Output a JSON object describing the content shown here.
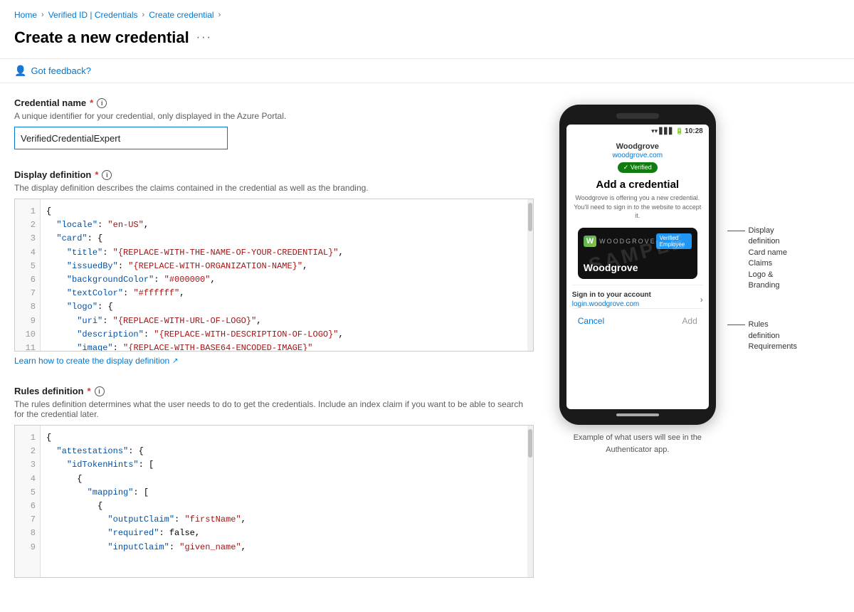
{
  "breadcrumb": {
    "home": "Home",
    "verified_id": "Verified ID | Credentials",
    "create_credential": "Create credential",
    "sep": "›"
  },
  "page_title": "Create a new credential",
  "page_title_menu": "···",
  "feedback": {
    "label": "Got feedback?"
  },
  "credential_name": {
    "label": "Credential name",
    "required": "*",
    "description": "A unique identifier for your credential, only displayed in the Azure Portal.",
    "value": "VerifiedCredentialExpert",
    "placeholder": ""
  },
  "display_definition": {
    "label": "Display definition",
    "required": "*",
    "description": "The display definition describes the claims contained in the credential as well as the branding.",
    "learn_link": "Learn how to create the display definition",
    "code_lines": [
      {
        "num": "1",
        "content": "{"
      },
      {
        "num": "2",
        "content": "  \"locale\": \"en-US\","
      },
      {
        "num": "3",
        "content": "  \"card\": {"
      },
      {
        "num": "4",
        "content": "    \"title\": \"{REPLACE-WITH-THE-NAME-OF-YOUR-CREDENTIAL}\","
      },
      {
        "num": "5",
        "content": "    \"issuedBy\": \"{REPLACE-WITH-ORGANIZATION-NAME}\","
      },
      {
        "num": "6",
        "content": "    \"backgroundColor\": \"#000000\","
      },
      {
        "num": "7",
        "content": "    \"textColor\": \"#ffffff\","
      },
      {
        "num": "8",
        "content": "    \"logo\": {"
      },
      {
        "num": "9",
        "content": "      \"uri\": \"{REPLACE-WITH-URL-OF-LOGO}\","
      },
      {
        "num": "10",
        "content": "      \"description\": \"{REPLACE-WITH-DESCRIPTION-OF-LOGO}\","
      },
      {
        "num": "11",
        "content": "      \"image\": \"{REPLACE-WITH-BASE64-ENCODED-IMAGE}\""
      }
    ]
  },
  "rules_definition": {
    "label": "Rules definition",
    "required": "*",
    "description": "The rules definition determines what the user needs to do to get the credentials. Include an index claim if you want to be able to search for the credential later.",
    "code_lines": [
      {
        "num": "1",
        "content": "{"
      },
      {
        "num": "2",
        "content": "  \"attestations\": {"
      },
      {
        "num": "3",
        "content": "    \"idTokenHints\": ["
      },
      {
        "num": "4",
        "content": "      {"
      },
      {
        "num": "5",
        "content": "        \"mapping\": ["
      },
      {
        "num": "6",
        "content": "          {"
      },
      {
        "num": "7",
        "content": "            \"outputClaim\": \"firstName\","
      },
      {
        "num": "8",
        "content": "            \"required\": false,"
      },
      {
        "num": "9",
        "content": "            \"inputClaim\": \"given_name\","
      }
    ]
  },
  "phone_preview": {
    "status_time": "10:28",
    "company_name": "Woodgrove",
    "company_url": "woodgrove.com",
    "verified_label": "✓ Verified",
    "add_credential_title": "Add a credential",
    "add_credential_desc": "Woodgrove is offering you a new credential. You'll need to sign in to the website to accept it.",
    "card_brand": "WOODGROVE",
    "card_badge": "Verified Employee",
    "card_holder": "Woodgrove",
    "sample_text": "SAMPLE",
    "signin_title": "Sign in to your account",
    "signin_link": "login.woodgrove.com",
    "btn_cancel": "Cancel",
    "btn_add": "Add"
  },
  "annotations": {
    "display_def": {
      "line1": "Display",
      "line2": "definition",
      "line3": "Card name",
      "line4": "Claims",
      "line5": "Logo &",
      "line6": "Branding"
    },
    "rules_def": {
      "line1": "Rules",
      "line2": "definition",
      "line3": "Requirements"
    }
  },
  "preview_caption": "Example of what users will see in the\nAuthenticator app."
}
